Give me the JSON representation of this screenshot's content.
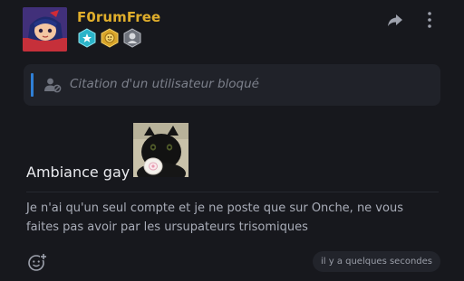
{
  "post": {
    "username": "F0rumFree",
    "avatar_icon": "anime-girl-avatar",
    "badges": [
      {
        "icon": "diamond-star-badge-icon",
        "color": "#2bb4c9"
      },
      {
        "icon": "gold-emblem-badge-icon",
        "color": "#d8a52a"
      },
      {
        "icon": "portrait-badge-icon",
        "color": "#8d9098"
      }
    ],
    "actions": {
      "share_icon": "share-arrow-icon",
      "more_icon": "kebab-menu-icon"
    },
    "quote": {
      "icon": "blocked-user-icon",
      "text": "Citation d'un utilisateur bloqué",
      "accent_color": "#2f7fd6"
    },
    "content_title": "Ambiance gay",
    "content_image_icon": "black-cat-pacifier-image",
    "body": "Je n'ai qu'un seul compte et je ne poste que sur Onche, ne vous faites pas avoir par les ursupateurs trisomiques",
    "reaction_icon": "add-reaction-icon",
    "timestamp": "il y a quelques secondes",
    "colors": {
      "username": "#e0ae2c",
      "background": "#17181d",
      "quote_bg": "#202229"
    }
  }
}
